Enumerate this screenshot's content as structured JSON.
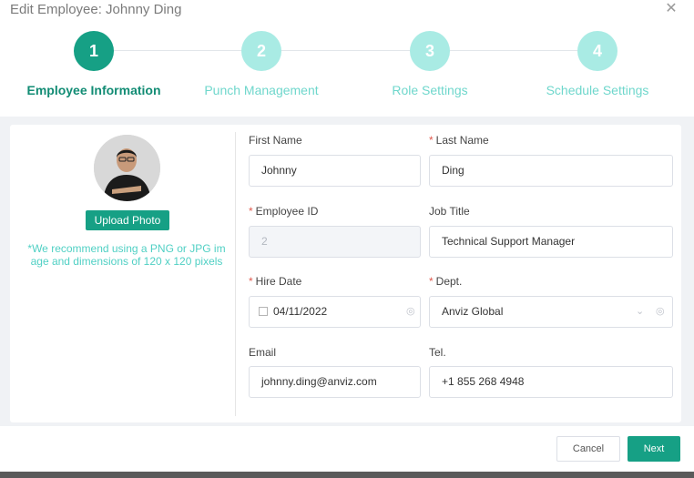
{
  "dialog": {
    "title": "Edit Employee: Johnny Ding",
    "close_icon": "close-icon"
  },
  "steps": [
    {
      "number": "1",
      "label": "Employee Information",
      "state": "active"
    },
    {
      "number": "2",
      "label": "Punch Management",
      "state": "inactive"
    },
    {
      "number": "3",
      "label": "Role Settings",
      "state": "inactive"
    },
    {
      "number": "4",
      "label": "Schedule Settings",
      "state": "inactive"
    }
  ],
  "photo": {
    "upload_label": "Upload Photo",
    "hint": "*We recommend using a PNG or JPG image and dimensions of 120 x 120 pixels"
  },
  "form": {
    "first_name": {
      "label": "First Name",
      "required": false,
      "value": "Johnny"
    },
    "last_name": {
      "label": "Last Name",
      "required": true,
      "value": "Ding"
    },
    "employee_id": {
      "label": "Employee ID",
      "required": true,
      "value": "2",
      "disabled": true
    },
    "job_title": {
      "label": "Job Title",
      "required": false,
      "value": "Technical Support Manager"
    },
    "hire_date": {
      "label": "Hire Date",
      "required": true,
      "value": "04/11/2022"
    },
    "dept": {
      "label": "Dept.",
      "required": true,
      "value": "Anviz Global"
    },
    "email": {
      "label": "Email",
      "required": false,
      "value": "johnny.ding@anviz.com"
    },
    "tel": {
      "label": "Tel.",
      "required": false,
      "value": "+1 855 268 4948"
    }
  },
  "footer": {
    "cancel_label": "Cancel",
    "next_label": "Next"
  },
  "colors": {
    "accent": "#16a085",
    "accent_light": "#a9ebe4",
    "required": "#e05a4e"
  }
}
